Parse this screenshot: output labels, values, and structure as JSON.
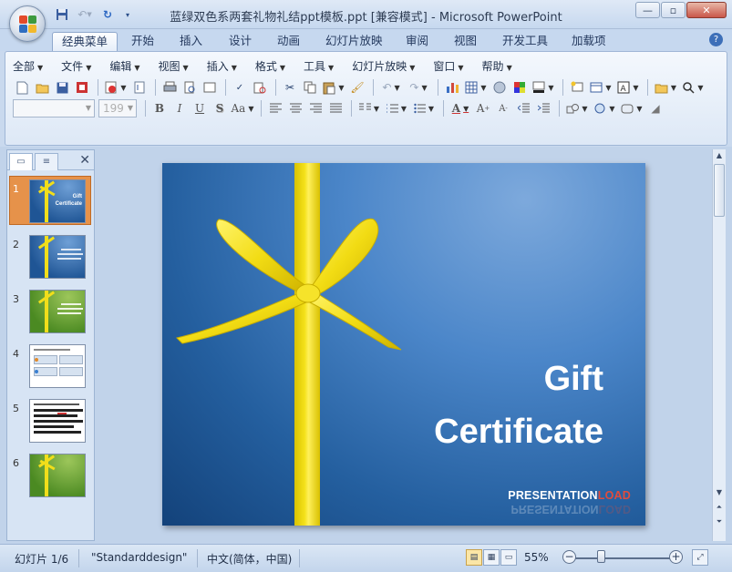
{
  "window": {
    "title": "蓝绿双色系两套礼物礼结ppt模板.ppt [兼容模式] - Microsoft PowerPoint",
    "controls": [
      "minimize",
      "maximize",
      "close"
    ]
  },
  "quick_access": [
    "save-icon",
    "undo-icon",
    "redo-icon",
    "customize-icon"
  ],
  "ribbon_tabs": [
    {
      "label": "经典菜单",
      "active": true
    },
    {
      "label": "开始"
    },
    {
      "label": "插入"
    },
    {
      "label": "设计"
    },
    {
      "label": "动画"
    },
    {
      "label": "幻灯片放映"
    },
    {
      "label": "审阅"
    },
    {
      "label": "视图"
    },
    {
      "label": "开发工具"
    },
    {
      "label": "加载项"
    }
  ],
  "classic_menu": [
    "全部",
    "文件",
    "编辑",
    "视图",
    "插入",
    "格式",
    "工具",
    "幻灯片放映",
    "窗口",
    "帮助"
  ],
  "font": {
    "name": "",
    "size": "199"
  },
  "slide_panel": {
    "tabs": [
      "slides-tab",
      "outline-tab"
    ],
    "selected": 1,
    "thumbnails": [
      {
        "number": "1",
        "theme": "blue",
        "title": "Gift Certificate"
      },
      {
        "number": "2",
        "theme": "blue"
      },
      {
        "number": "3",
        "theme": "green"
      },
      {
        "number": "4",
        "theme": "white-table"
      },
      {
        "number": "5",
        "theme": "white-text"
      },
      {
        "number": "6",
        "theme": "green"
      }
    ]
  },
  "slide": {
    "title_line1": "Gift",
    "title_line2": "Certificate",
    "brand_main": "PRESENTATION",
    "brand_accent": "LOAD",
    "colors": {
      "background": "#245f9f",
      "ribbon": "#f4e11a",
      "accent": "#e04c3c"
    }
  },
  "status": {
    "slide_info": "幻灯片 1/6",
    "theme": "\"Standarddesign\"",
    "language": "中文(简体，中国)",
    "zoom": "55%"
  }
}
